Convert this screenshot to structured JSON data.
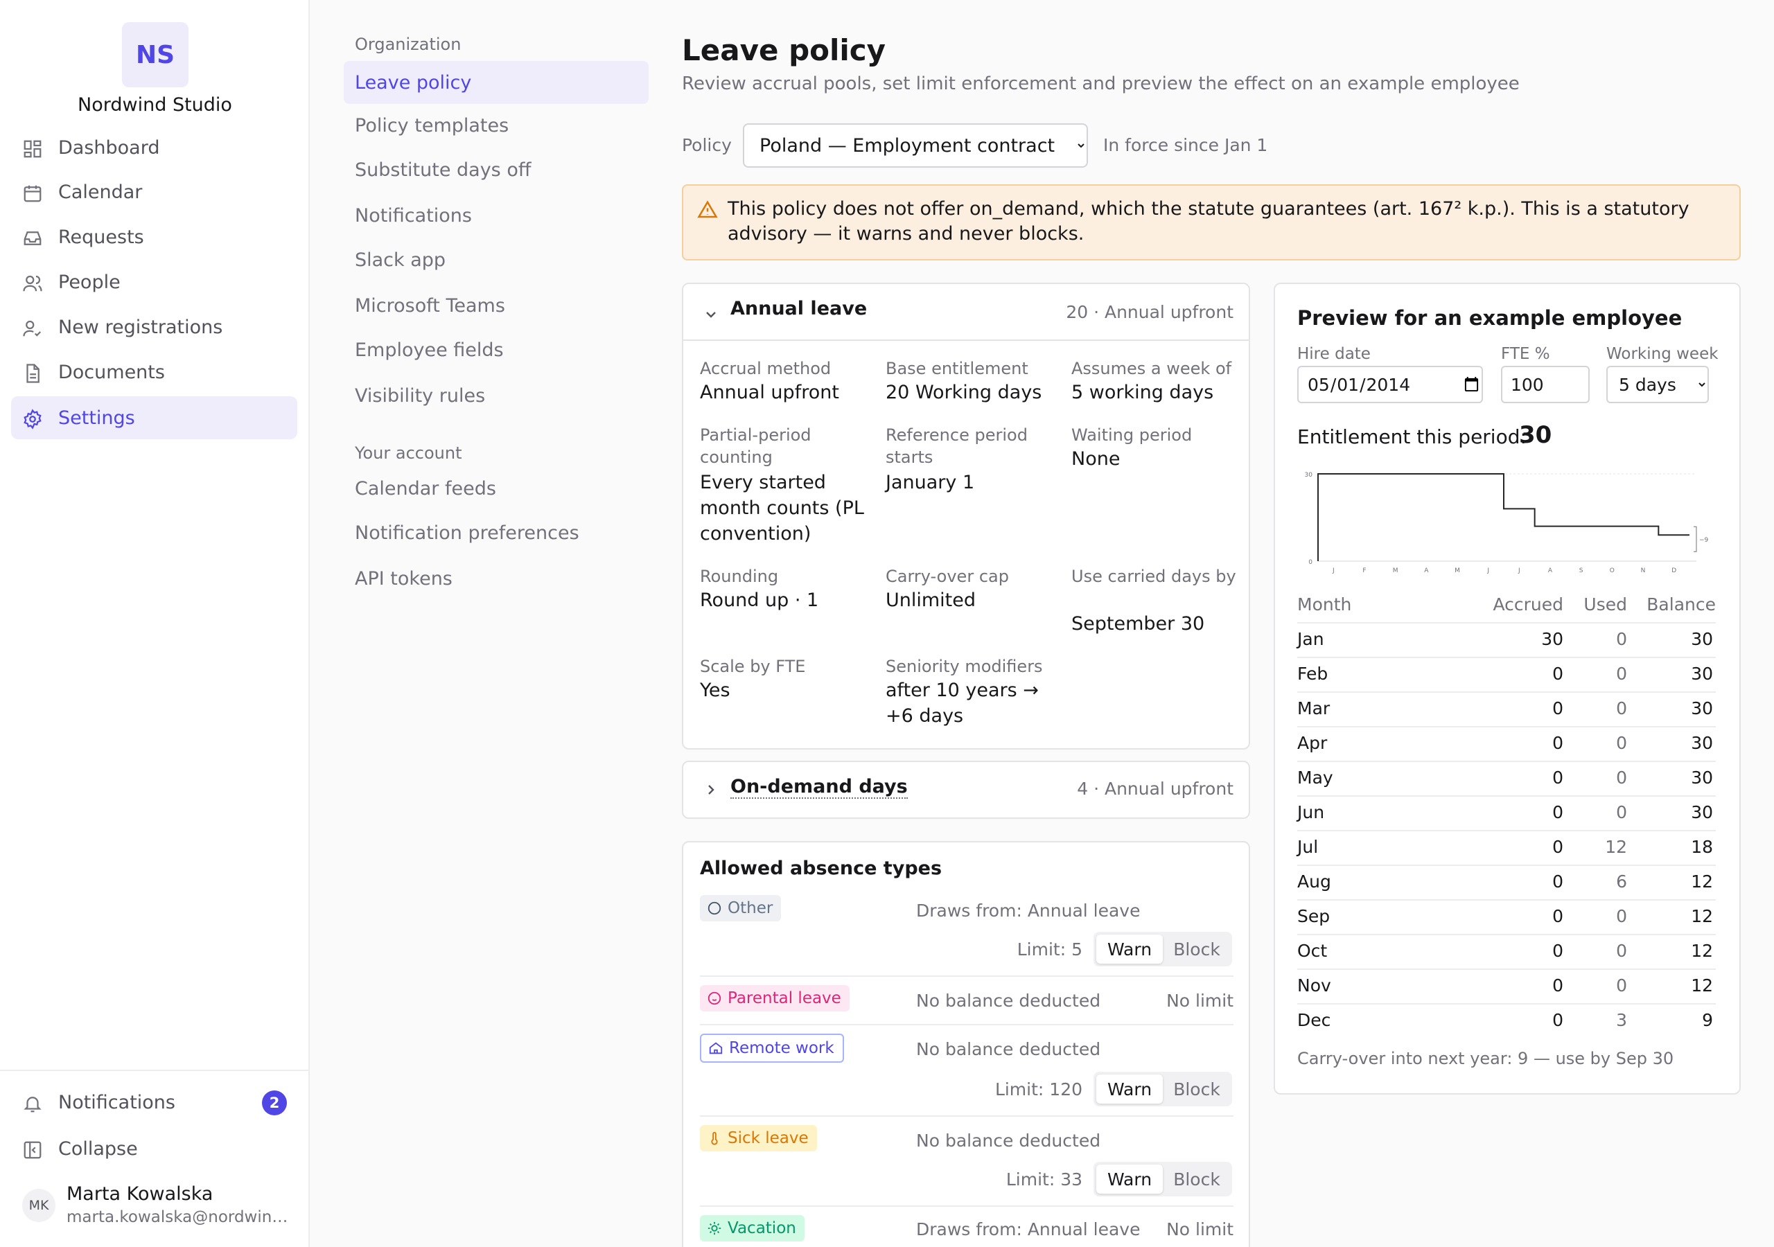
{
  "sidebar": {
    "org_initials": "NS",
    "org_name": "Nordwind Studio",
    "nav": [
      {
        "label": "Dashboard",
        "icon": "dashboard-icon"
      },
      {
        "label": "Calendar",
        "icon": "calendar-icon"
      },
      {
        "label": "Requests",
        "icon": "inbox-icon"
      },
      {
        "label": "People",
        "icon": "people-icon"
      },
      {
        "label": "New registrations",
        "icon": "user-check-icon"
      },
      {
        "label": "Documents",
        "icon": "document-icon"
      },
      {
        "label": "Settings",
        "icon": "gear-icon",
        "active": true
      }
    ],
    "notifications_label": "Notifications",
    "notifications_count": "2",
    "collapse_label": "Collapse",
    "user": {
      "initials": "MK",
      "name": "Marta Kowalska",
      "email": "marta.kowalska@nordwind.studio"
    }
  },
  "settings_nav": {
    "org_heading": "Organization",
    "org_items": [
      "Leave policy",
      "Policy templates",
      "Substitute days off",
      "Notifications",
      "Slack app",
      "Microsoft Teams",
      "Employee fields",
      "Visibility rules"
    ],
    "account_heading": "Your account",
    "account_items": [
      "Calendar feeds",
      "Notification preferences",
      "API tokens"
    ]
  },
  "main": {
    "title": "Leave policy",
    "subtitle": "Review accrual pools, set limit enforcement and preview the effect on an example employee",
    "policy_label": "Policy",
    "policy_selected": "Poland — Employment contract",
    "policy_since": "In force since Jan 1",
    "advisory": "This policy does not offer on_demand, which the statute guarantees (art. 167² k.p.). This is a statutory advisory — it warns and never blocks.",
    "advisory_color": "#fcefe0",
    "accent_color": "#4f46e5"
  },
  "annual_leave": {
    "title": "Annual leave",
    "meta": "20 · Annual upfront",
    "fields": [
      {
        "label": "Accrual method",
        "value": "Annual upfront"
      },
      {
        "label": "Base entitlement",
        "value": "20 Working days"
      },
      {
        "label": "Assumes a week of",
        "value": "5 working days"
      },
      {
        "label": "Partial-period counting",
        "value": "Every started month counts (PL convention)"
      },
      {
        "label": "Reference period starts",
        "value": "January 1"
      },
      {
        "label": "Waiting period",
        "value": "None"
      },
      {
        "label": "Rounding",
        "value": "Round up · 1"
      },
      {
        "label": "Carry-over cap",
        "value": "Unlimited"
      },
      {
        "label": "Use carried days by",
        "value": "September 30"
      },
      {
        "label": "Scale by FTE",
        "value": "Yes"
      },
      {
        "label": "Seniority modifiers",
        "value": "after 10 years → +6 days"
      }
    ]
  },
  "on_demand": {
    "title": "On-demand days",
    "meta": "4 · Annual upfront"
  },
  "absence_types": {
    "title": "Allowed absence types",
    "warn_label": "Warn",
    "block_label": "Block",
    "items": [
      {
        "name": "Other",
        "icon": "circle-icon",
        "source": "Draws from: Annual leave",
        "limit": "Limit: 5",
        "selected": "Warn"
      },
      {
        "name": "Parental leave",
        "icon": "baby-icon",
        "source": "No balance deducted",
        "limit": "No limit"
      },
      {
        "name": "Remote work",
        "icon": "home-icon",
        "source": "No balance deducted",
        "limit": "Limit: 120",
        "selected": "Warn"
      },
      {
        "name": "Sick leave",
        "icon": "thermometer-icon",
        "source": "No balance deducted",
        "limit": "Limit: 33",
        "selected": "Warn"
      },
      {
        "name": "Vacation",
        "icon": "sun-icon",
        "source": "Draws from: Annual leave",
        "limit": "No limit"
      }
    ]
  },
  "preview": {
    "title": "Preview for an example employee",
    "hire_date_label": "Hire date",
    "hire_date": "2014-05-01",
    "fte_label": "FTE %",
    "fte": "100",
    "week_label": "Working week",
    "week": "5 days",
    "entitlement_label": "Entitlement this period:",
    "entitlement": "30",
    "table_headers": [
      "Month",
      "Accrued",
      "Used",
      "Balance"
    ],
    "rows": [
      [
        "Jan",
        "30",
        "0",
        "30"
      ],
      [
        "Feb",
        "0",
        "0",
        "30"
      ],
      [
        "Mar",
        "0",
        "0",
        "30"
      ],
      [
        "Apr",
        "0",
        "0",
        "30"
      ],
      [
        "May",
        "0",
        "0",
        "30"
      ],
      [
        "Jun",
        "0",
        "0",
        "30"
      ],
      [
        "Jul",
        "0",
        "12",
        "18"
      ],
      [
        "Aug",
        "0",
        "6",
        "12"
      ],
      [
        "Sep",
        "0",
        "0",
        "12"
      ],
      [
        "Oct",
        "0",
        "0",
        "12"
      ],
      [
        "Nov",
        "0",
        "0",
        "12"
      ],
      [
        "Dec",
        "0",
        "3",
        "9"
      ]
    ],
    "carry_over": "Carry-over into next year: 9 — use by Sep 30"
  },
  "chart_data": {
    "type": "line",
    "categories": [
      "J",
      "F",
      "M",
      "A",
      "M",
      "J",
      "J",
      "A",
      "S",
      "O",
      "N",
      "D"
    ],
    "series": [
      {
        "values": [
          30,
          30,
          30,
          30,
          30,
          30,
          18,
          12,
          12,
          12,
          12,
          9
        ]
      }
    ],
    "ylim": [
      0,
      30
    ],
    "yticks": [
      "0",
      "30"
    ],
    "end_annotation": "−9"
  }
}
